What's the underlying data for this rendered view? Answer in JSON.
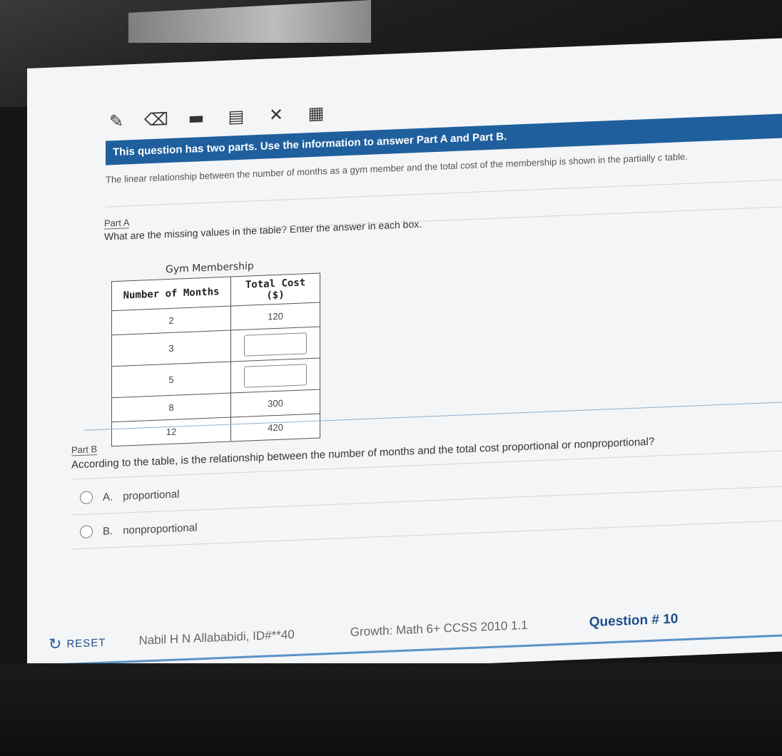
{
  "toolbar": {
    "tools": [
      {
        "name": "pencil-icon",
        "glyph": "✎"
      },
      {
        "name": "eraser-icon",
        "glyph": "⌫"
      },
      {
        "name": "highlighter-icon",
        "glyph": "▬"
      },
      {
        "name": "notepad-icon",
        "glyph": "▤"
      },
      {
        "name": "answer-eliminator-icon",
        "glyph": "✕"
      },
      {
        "name": "calculator-icon",
        "glyph": "▦"
      }
    ]
  },
  "banner": "This question has two parts. Use the information to answer Part A and Part B.",
  "intro": "The linear relationship between the number of months as a gym member and the total cost of the membership is shown in the partially c table.",
  "part_a": {
    "label": "Part A",
    "question": "What are the missing values in the table? Enter the answer in each box."
  },
  "table": {
    "title": "Gym Membership",
    "headers": [
      "Number of Months",
      "Total Cost ($)"
    ],
    "rows": [
      {
        "months": "2",
        "cost": "120"
      },
      {
        "months": "3",
        "cost": ""
      },
      {
        "months": "5",
        "cost": ""
      },
      {
        "months": "8",
        "cost": "300"
      },
      {
        "months": "12",
        "cost": "420"
      }
    ]
  },
  "part_b": {
    "label": "Part B",
    "question": "According to the table, is the relationship between the number of months and the total cost proportional or nonproportional?",
    "options": [
      {
        "letter": "A.",
        "text": "proportional"
      },
      {
        "letter": "B.",
        "text": "nonproportional"
      }
    ]
  },
  "footer": {
    "reset_label": "RESET",
    "student": "Nabil H N Allababidi, ID#**40",
    "course": "Growth: Math 6+ CCSS 2010 1.1",
    "question_number": "Question # 10"
  },
  "colors": {
    "accent": "#1f5f9e",
    "background": "#f4f5f6"
  }
}
